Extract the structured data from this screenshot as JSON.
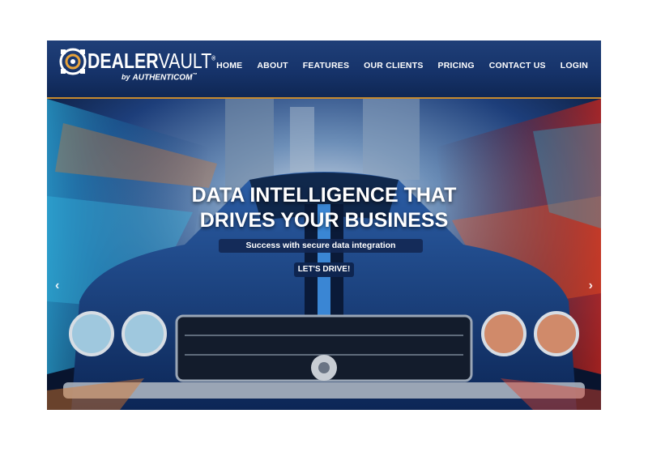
{
  "brand": {
    "name_dealer": "DEALER",
    "name_vault": "VAULT",
    "tm": "®",
    "by": "by",
    "parent": "AUTHENTICOM",
    "parent_tm": "™"
  },
  "nav": {
    "items": [
      {
        "label": "HOME"
      },
      {
        "label": "ABOUT"
      },
      {
        "label": "FEATURES"
      },
      {
        "label": "OUR CLIENTS"
      },
      {
        "label": "PRICING"
      },
      {
        "label": "CONTACT US"
      },
      {
        "label": "LOGIN"
      }
    ]
  },
  "hero": {
    "title_line1": "DATA INTELLIGENCE THAT",
    "title_line2": "DRIVES YOUR BUSINESS",
    "subtitle": "Success with secure data integration",
    "cta": "LET'S DRIVE!",
    "prev_arrow": "‹",
    "next_arrow": "›"
  },
  "colors": {
    "nav_bg": "#16336a",
    "accent_border": "#c88a2e",
    "cta_bg": "#0e2550"
  }
}
